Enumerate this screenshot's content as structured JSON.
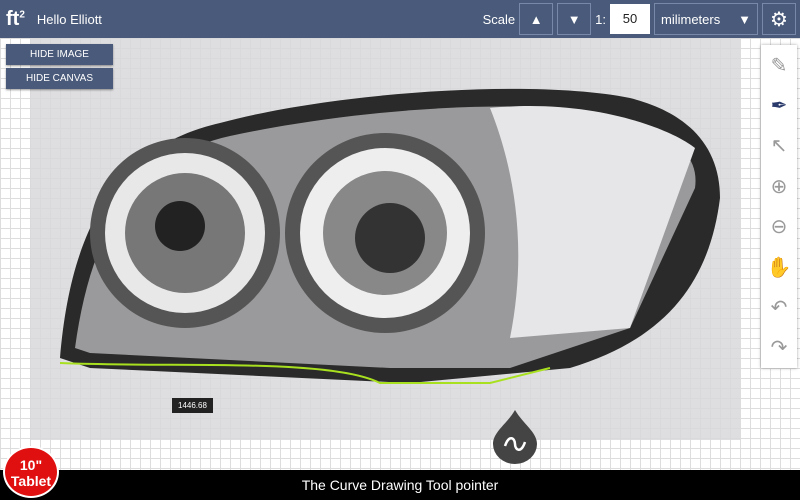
{
  "header": {
    "logo": "ft",
    "logo_sup": "2",
    "greeting": "Hello Elliott",
    "scale_label": "Scale",
    "ratio_prefix": "1:",
    "scale_value": "50",
    "unit": "milimeters"
  },
  "buttons": {
    "hide_image": "HIDE IMAGE",
    "hide_canvas": "HIDE CANVAS"
  },
  "measurement": "1446.68",
  "footer": "The Curve Drawing Tool pointer",
  "badge": {
    "line1": "10\"",
    "line2": "Tablet"
  },
  "colors": {
    "header": "#4a5a7a",
    "curve": "#a8e020",
    "badge": "#e01010"
  }
}
